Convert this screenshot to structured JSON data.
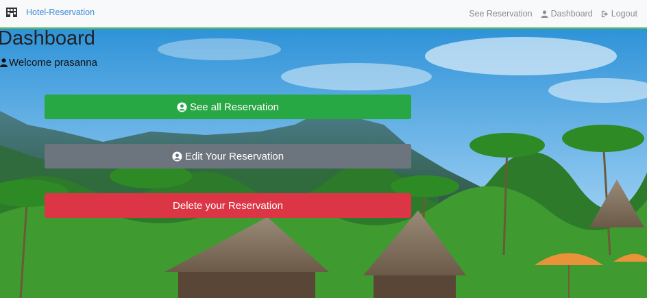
{
  "navbar": {
    "brand_icon": "hotel-icon",
    "brand": "Hotel-Reservation",
    "links": [
      {
        "label": "See Reservation",
        "icon": ""
      },
      {
        "label": "Dashboard",
        "icon": "user-icon"
      },
      {
        "label": "Logout",
        "icon": "logout-icon"
      }
    ],
    "accent": "#5cb85c"
  },
  "page": {
    "title": "Dashboard",
    "welcome": "Welcome prasanna"
  },
  "actions": [
    {
      "label": "See all Reservation",
      "icon": "user-circle-icon",
      "color": "#28a745"
    },
    {
      "label": "Edit Your Reservation",
      "icon": "user-circle-icon",
      "color": "#6c757d"
    },
    {
      "label": "Delete your Reservation",
      "icon": "",
      "color": "#dc3545"
    }
  ]
}
